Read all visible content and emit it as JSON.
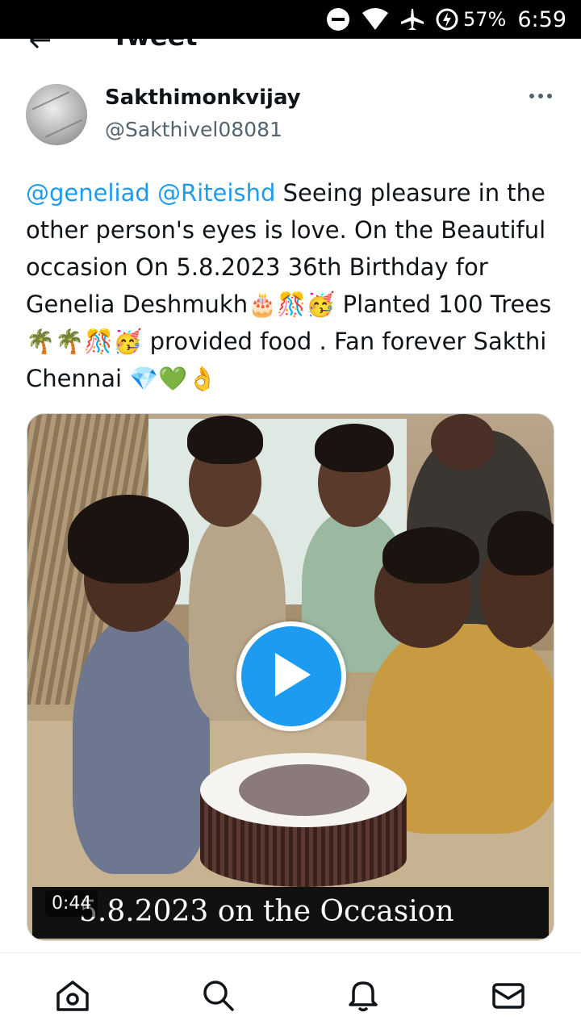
{
  "status_bar": {
    "battery_percent": "57%",
    "time": "6:59",
    "icons": [
      "do-not-disturb-icon",
      "wifi-icon",
      "airplane-icon",
      "battery-charging-icon"
    ]
  },
  "header": {
    "title": "Tweet",
    "back_icon": "arrow-left-icon"
  },
  "tweet": {
    "display_name": "Sakthimonkvijay",
    "handle": "@Sakthivel08081",
    "mentions": [
      "@geneliad",
      "@Riteishd"
    ],
    "text_segments": [
      "Seeing pleasure in the other person's eyes is love. On the Beautiful occasion On 5.8.2023 36th Birthday for Genelia Deshmukh🎂🎊🥳 Planted 100 Trees🌴🌴🎊🥳 provided food . Fan forever Sakthi Chennai 💎💚👌"
    ],
    "more_icon": "more-horizontal-icon"
  },
  "media": {
    "type": "video",
    "duration": "0:44",
    "caption": "5.8.2023 on the Occasion",
    "play_icon": "play-icon"
  },
  "bottom_nav": {
    "items": [
      "home-icon",
      "search-icon",
      "notifications-icon",
      "messages-icon"
    ]
  },
  "colors": {
    "accent": "#1d9bf0",
    "text": "#0f1419",
    "secondary_text": "#536471"
  }
}
